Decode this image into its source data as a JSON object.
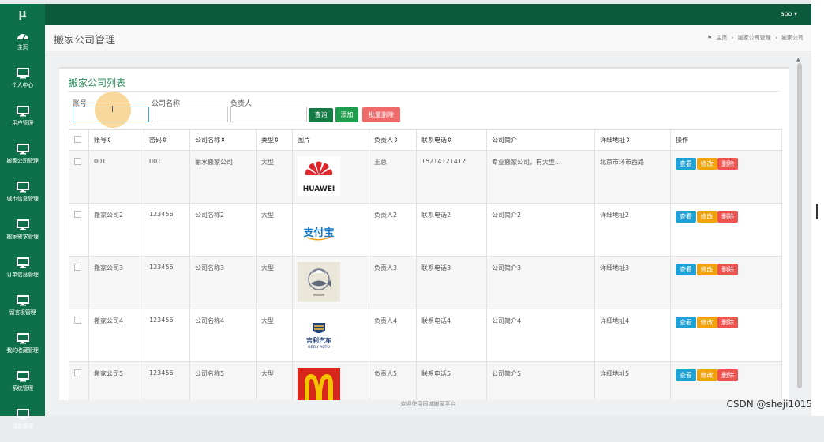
{
  "app": {
    "brand": "μ",
    "user_menu": "abo ▾"
  },
  "sidebar": {
    "items": [
      {
        "icon": "dashboard-icon",
        "label": "主页"
      },
      {
        "icon": "monitor-icon",
        "label": "个人中心"
      },
      {
        "icon": "monitor-icon",
        "label": "用户管理"
      },
      {
        "icon": "monitor-icon",
        "label": "搬家公司管理"
      },
      {
        "icon": "monitor-icon",
        "label": "城市信息管理"
      },
      {
        "icon": "monitor-icon",
        "label": "搬家需求管理"
      },
      {
        "icon": "monitor-icon",
        "label": "订单信息管理"
      },
      {
        "icon": "monitor-icon",
        "label": "留言板管理"
      },
      {
        "icon": "monitor-icon",
        "label": "我的收藏管理"
      },
      {
        "icon": "monitor-icon",
        "label": "系统管理"
      },
      {
        "icon": "monitor-icon",
        "label": "留言管理"
      }
    ]
  },
  "header": {
    "title": "搬家公司管理",
    "breadcrumb": [
      "主页",
      "搬家公司管理",
      "搬家公司"
    ]
  },
  "panel": {
    "title": "搬家公司列表"
  },
  "filters": {
    "account_label": "账号",
    "company_label": "公司名称",
    "manager_label": "负责人",
    "query_btn": "查询",
    "add_btn": "添加",
    "batch_delete_btn": "批量删除"
  },
  "table": {
    "headers": [
      "账号⇕",
      "密码⇕",
      "公司名称⇕",
      "类型⇕",
      "图片",
      "负责人⇕",
      "联系电话⇕",
      "公司简介",
      "详细地址⇕",
      "操作"
    ],
    "actions": {
      "view": "查看",
      "edit": "修改",
      "delete": "删除"
    },
    "rows": [
      {
        "account": "001",
        "password": "001",
        "company": "丽水搬家公司",
        "type": "大型",
        "image": "HUAWEI",
        "manager": "王总",
        "phone": "15214121412",
        "intro": "专业搬家公司，有大型...",
        "address": "北京市环市西路"
      },
      {
        "account": "搬家公司2",
        "password": "123456",
        "company": "公司名称2",
        "type": "大型",
        "image": "支付宝",
        "manager": "负责人2",
        "phone": "联系电话2",
        "intro": "公司简介2",
        "address": "详细地址2"
      },
      {
        "account": "搬家公司3",
        "password": "123456",
        "company": "公司名称3",
        "type": "大型",
        "image": "",
        "manager": "负责人3",
        "phone": "联系电话3",
        "intro": "公司简介3",
        "address": "详细地址3"
      },
      {
        "account": "搬家公司4",
        "password": "123456",
        "company": "公司名称4",
        "type": "大型",
        "image": "吉利汽车",
        "image_sub": "GEELY AUTO",
        "manager": "负责人4",
        "phone": "联系电话4",
        "intro": "公司简介4",
        "address": "详细地址4"
      },
      {
        "account": "搬家公司5",
        "password": "123456",
        "company": "公司名称5",
        "type": "大型",
        "image": "",
        "manager": "负责人5",
        "phone": "联系电话5",
        "intro": "公司简介5",
        "address": "详细地址5"
      }
    ]
  },
  "footer": "欢迎使用同城搬家平台",
  "watermark": "CSDN @sheji1015",
  "colors": {
    "sidebar": "#0e6f4b",
    "topbar": "#0b5a3d",
    "accent": "#2a8a5a"
  }
}
